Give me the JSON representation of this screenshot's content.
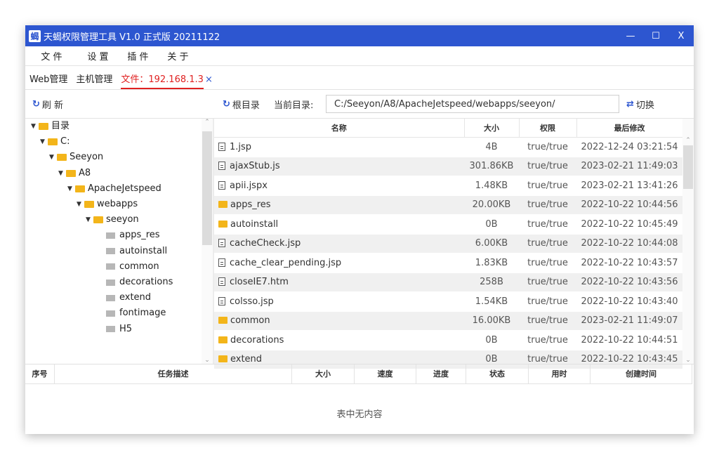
{
  "window": {
    "title": "天蝎权限管理工具 V1.0 正式版 20211122",
    "app_icon": "蝎",
    "controls": {
      "minimize": "—",
      "maximize": "☐",
      "close": "X"
    }
  },
  "menu": [
    "文 件",
    "设 置",
    "插 件",
    "关 于"
  ],
  "tabs": [
    {
      "label": "Web管理"
    },
    {
      "label": "主机管理"
    },
    {
      "label": "文件：192.168.1.3",
      "close": "×"
    }
  ],
  "toolbar": {
    "refresh_icon": "↻",
    "refresh": "刷 新",
    "root_icon": "↻",
    "root": "根目录",
    "current_dir_label": "当前目录:",
    "path": "C:/Seeyon/A8/ApacheJetspeed/webapps/seeyon/",
    "switch_icon": "⇄",
    "switch": "切换"
  },
  "tree": {
    "scroll_up": "⌃",
    "scroll_down": "⌄",
    "nodes": [
      {
        "label": "目录",
        "depth": 0,
        "expanded": true
      },
      {
        "label": "C:",
        "depth": 1,
        "expanded": true
      },
      {
        "label": "Seeyon",
        "depth": 2,
        "expanded": true
      },
      {
        "label": "A8",
        "depth": 3,
        "expanded": true
      },
      {
        "label": "ApacheJetspeed",
        "depth": 4,
        "expanded": true
      },
      {
        "label": "webapps",
        "depth": 5,
        "expanded": true
      },
      {
        "label": "seeyon",
        "depth": 6,
        "expanded": true
      },
      {
        "label": "apps_res",
        "depth": 7,
        "leaf": true
      },
      {
        "label": "autoinstall",
        "depth": 7,
        "leaf": true
      },
      {
        "label": "common",
        "depth": 7,
        "leaf": true
      },
      {
        "label": "decorations",
        "depth": 7,
        "leaf": true
      },
      {
        "label": "extend",
        "depth": 7,
        "leaf": true
      },
      {
        "label": "fontimage",
        "depth": 7,
        "leaf": true
      },
      {
        "label": "H5",
        "depth": 7,
        "leaf": true
      }
    ]
  },
  "files": {
    "columns": [
      "名称",
      "大小",
      "权限",
      "最后修改"
    ],
    "scroll_up": "⌃",
    "scroll_down": "⌄",
    "rows": [
      {
        "type": "file",
        "name": "1.jsp",
        "size": "4B",
        "perm": "true/true",
        "modified": "2022-12-24 03:21:54"
      },
      {
        "type": "file",
        "name": "ajaxStub.js",
        "size": "301.86KB",
        "perm": "true/true",
        "modified": "2023-02-21 11:49:03"
      },
      {
        "type": "file",
        "name": "apii.jspx",
        "size": "1.48KB",
        "perm": "true/true",
        "modified": "2023-02-21 13:41:26"
      },
      {
        "type": "dir",
        "name": "apps_res",
        "size": "20.00KB",
        "perm": "true/true",
        "modified": "2022-10-22 10:44:56"
      },
      {
        "type": "dir",
        "name": "autoinstall",
        "size": "0B",
        "perm": "true/true",
        "modified": "2022-10-22 10:45:49"
      },
      {
        "type": "file",
        "name": "cacheCheck.jsp",
        "size": "6.00KB",
        "perm": "true/true",
        "modified": "2022-10-22 10:44:08"
      },
      {
        "type": "file",
        "name": "cache_clear_pending.jsp",
        "size": "1.83KB",
        "perm": "true/true",
        "modified": "2022-10-22 10:43:57"
      },
      {
        "type": "file",
        "name": "closeIE7.htm",
        "size": "258B",
        "perm": "true/true",
        "modified": "2022-10-22 10:43:56"
      },
      {
        "type": "file",
        "name": "colsso.jsp",
        "size": "1.54KB",
        "perm": "true/true",
        "modified": "2022-10-22 10:43:40"
      },
      {
        "type": "dir",
        "name": "common",
        "size": "16.00KB",
        "perm": "true/true",
        "modified": "2023-02-21 11:49:07"
      },
      {
        "type": "dir",
        "name": "decorations",
        "size": "0B",
        "perm": "true/true",
        "modified": "2022-10-22 10:44:51"
      },
      {
        "type": "dir",
        "name": "extend",
        "size": "0B",
        "perm": "true/true",
        "modified": "2022-10-22 10:43:45"
      }
    ]
  },
  "tasks": {
    "columns": [
      "序号",
      "任务描述",
      "大小",
      "速度",
      "进度",
      "状态",
      "用时",
      "创建时间"
    ],
    "empty": "表中无内容"
  }
}
